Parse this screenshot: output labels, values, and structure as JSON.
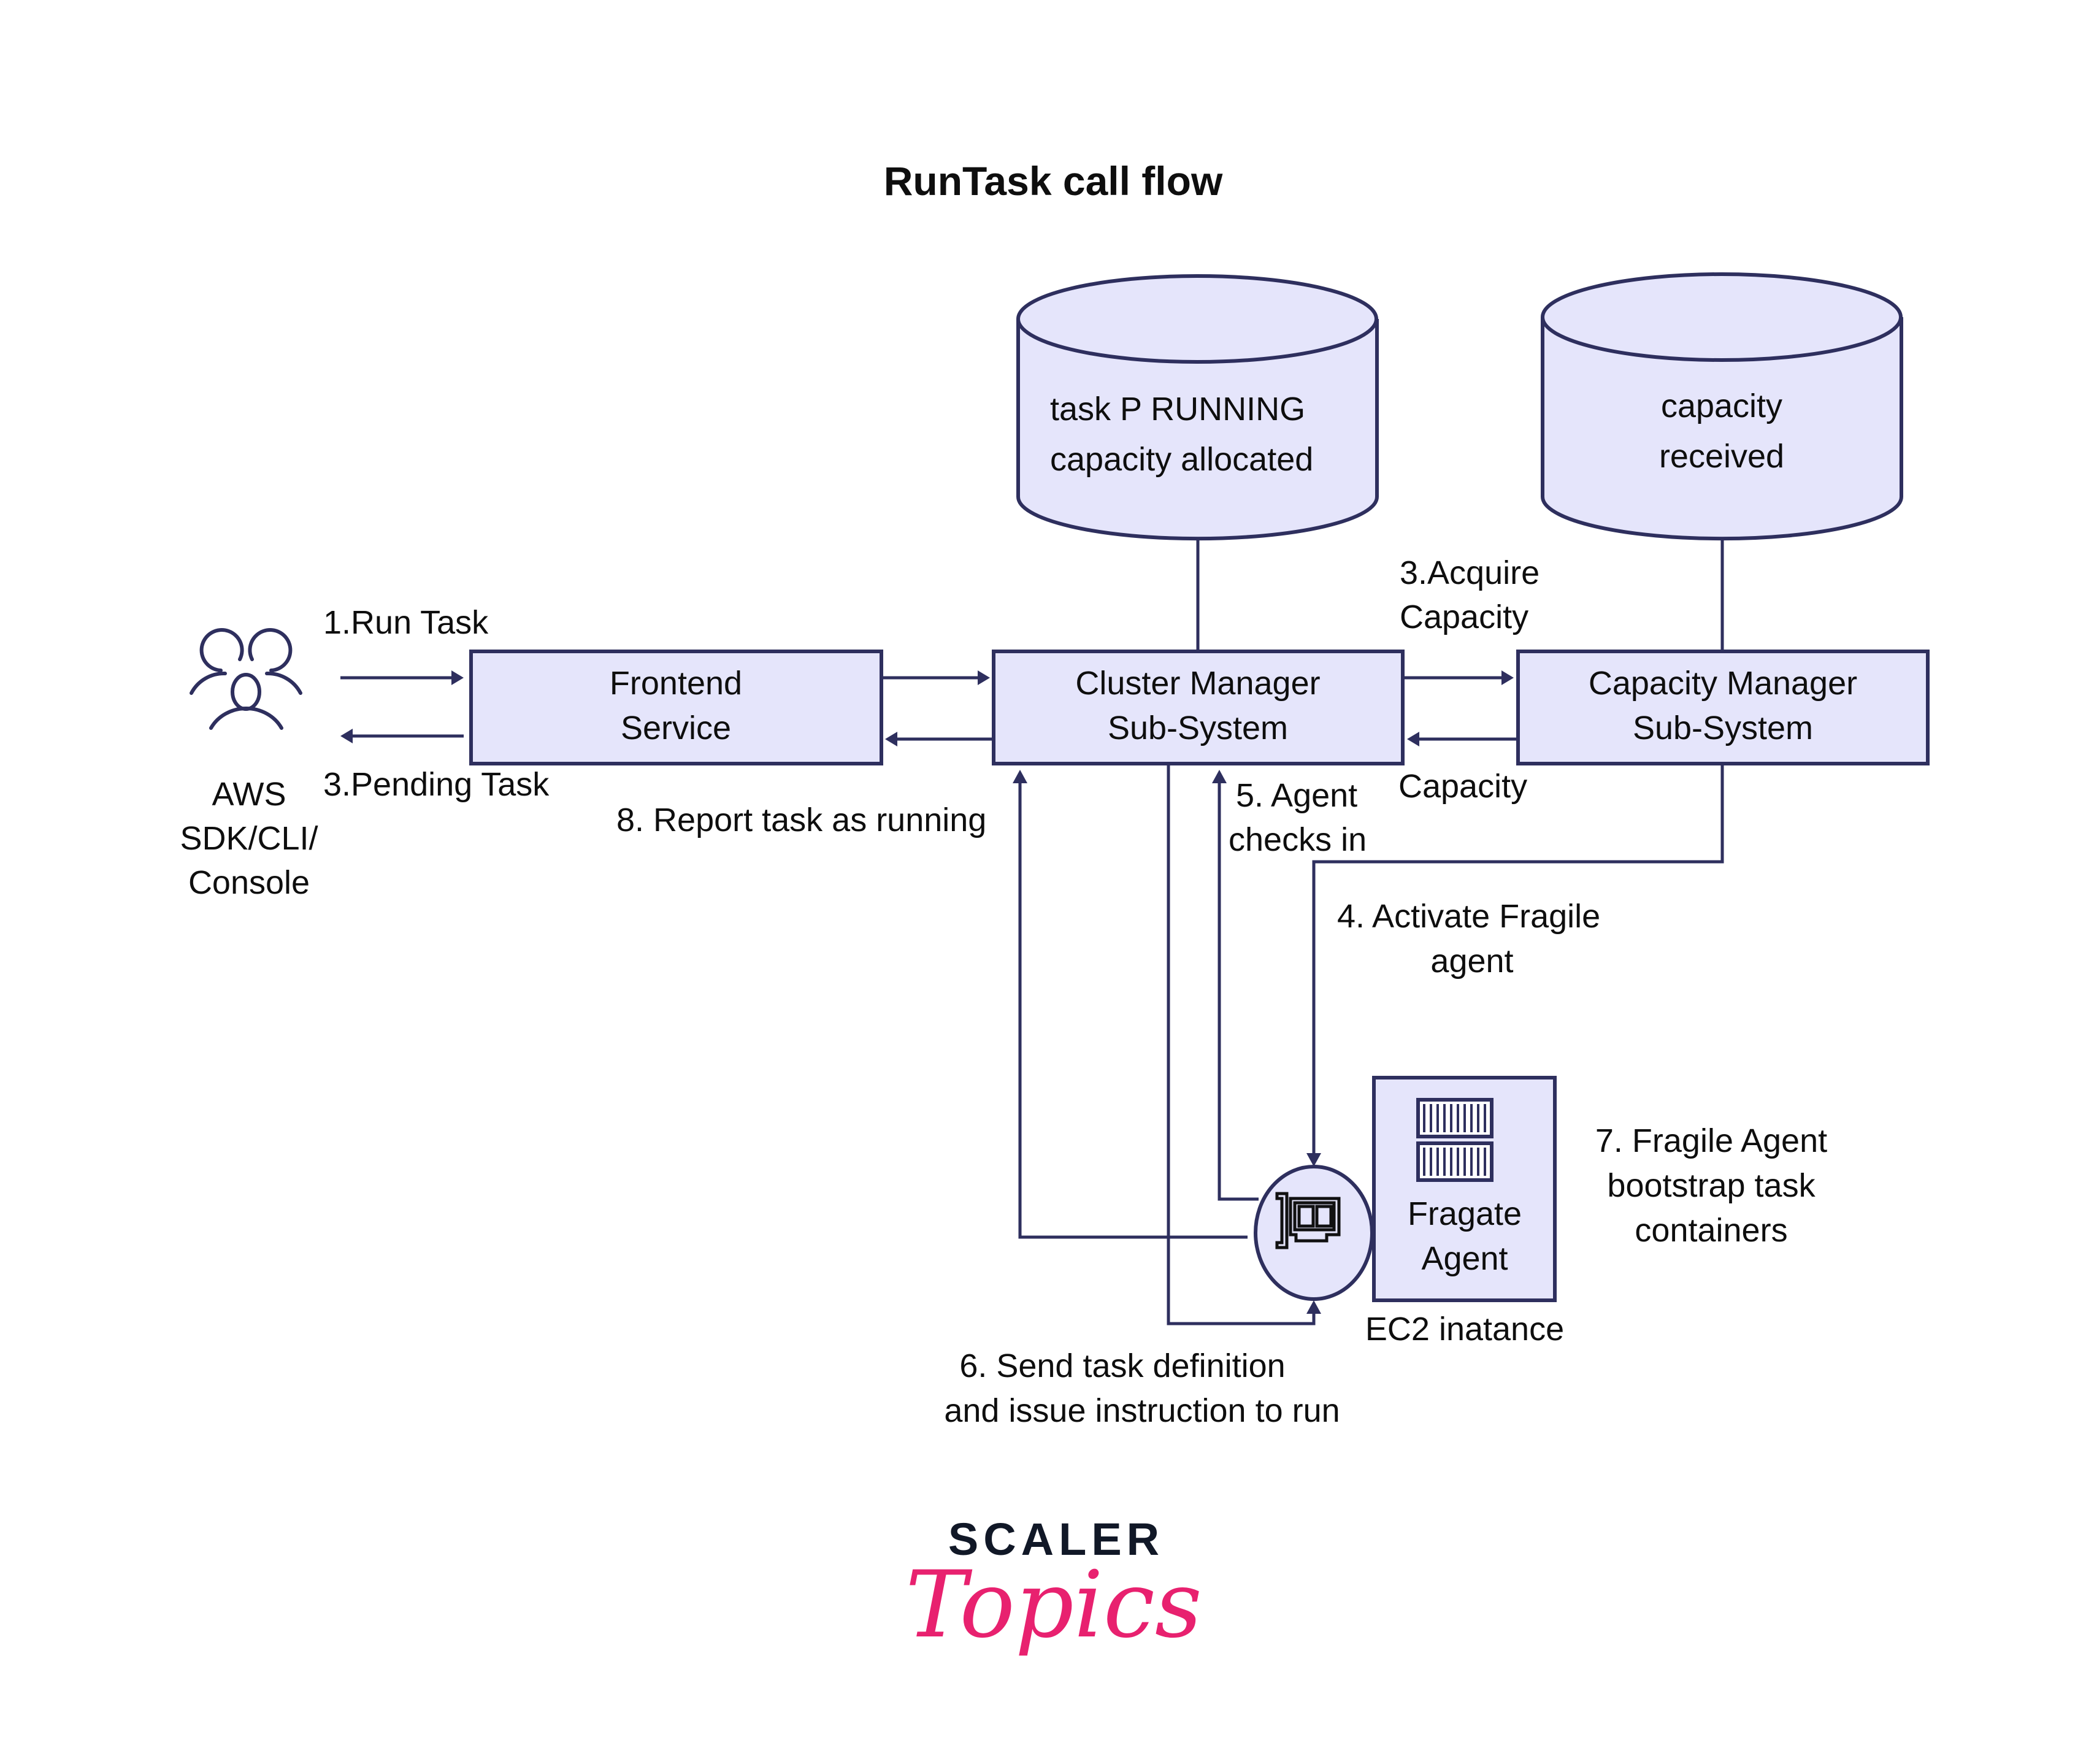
{
  "title": "RunTask call flow",
  "colors": {
    "box_fill": "#e5e5fb",
    "stroke": "#2e2f5e",
    "text": "#0e0e0e",
    "brand_dark": "#111827",
    "brand_pink": "#e8216f"
  },
  "actors": {
    "client": {
      "icon": "users-icon",
      "label_lines": [
        "AWS",
        "SDK/CLI/",
        "Console"
      ]
    }
  },
  "nodes": {
    "frontend": {
      "lines": [
        "Frontend",
        "Service"
      ]
    },
    "cluster_manager": {
      "lines": [
        "Cluster Manager",
        "Sub-System"
      ]
    },
    "capacity_manager": {
      "lines": [
        "Capacity Manager",
        "Sub-System"
      ]
    },
    "db_cluster": {
      "lines": [
        "task P RUNNING",
        "capacity allocated"
      ]
    },
    "db_capacity": {
      "lines": [
        "capacity",
        "received"
      ]
    },
    "agent_node": {
      "icon": "network-card-icon"
    },
    "fragate_agent": {
      "icon": "containers-icon",
      "lines": [
        "Fragate",
        "Agent"
      ],
      "caption": "EC2 inatance"
    }
  },
  "edges": {
    "run_task": "1.Run Task",
    "pending_task": "3.Pending Task",
    "acquire_capacity": [
      "3.Acquire",
      "Capacity"
    ],
    "capacity": "Capacity",
    "activate_agent": [
      "4. Activate Fragile",
      "agent"
    ],
    "agent_checks_in": [
      "5. Agent",
      "checks in"
    ],
    "send_task_def": [
      "6. Send task definition",
      "and issue instruction to run"
    ],
    "bootstrap": [
      "7. Fragile Agent",
      "bootstrap task",
      "containers"
    ],
    "report_running": "8. Report task as running"
  },
  "brand": {
    "line1": "SCALER",
    "line2": "Topics"
  }
}
